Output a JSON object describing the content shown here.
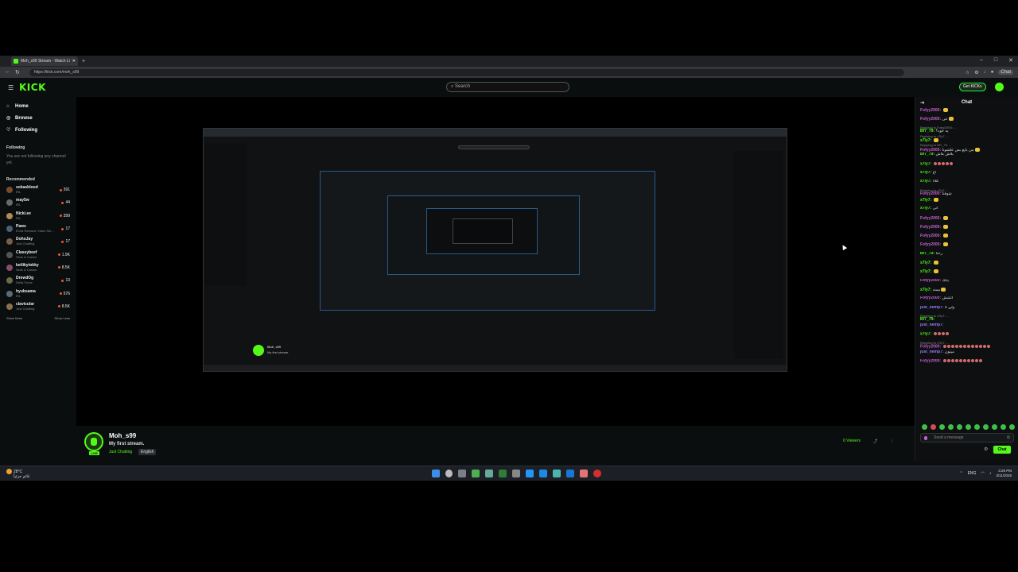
{
  "browser": {
    "tab_title": "Moh_s99 Stream - Watch Live",
    "url": "https://kick.com/moh_s99",
    "extension_chat_label": "Chat"
  },
  "header": {
    "logo": "KICK",
    "search_placeholder": "Search",
    "get_kicks_label": "Get KICKs"
  },
  "sidebar": {
    "nav": [
      {
        "label": "Home",
        "icon": "home-icon"
      },
      {
        "label": "Browse",
        "icon": "compass-icon"
      },
      {
        "label": "Following",
        "icon": "heart-icon"
      }
    ],
    "following_title": "Following",
    "following_empty": "You are not following any channel yet.",
    "recommended_title": "Recommended",
    "recommended": [
      {
        "name": "sokasblood",
        "category": "IRL",
        "viewers": "391",
        "color": "#7a4b2a"
      },
      {
        "name": "may5w",
        "category": "IRL",
        "viewers": "44",
        "color": "#6a6a6a"
      },
      {
        "name": "Nicki.ee",
        "category": "IRL",
        "viewers": "399",
        "color": "#b38a55"
      },
      {
        "name": "Paws",
        "category": "Extra Revised: Video Sto...",
        "viewers": "17",
        "color": "#4a5e7a"
      },
      {
        "name": "DohoJay",
        "category": "Just Chatting",
        "viewers": "17",
        "color": "#7b5e4a"
      },
      {
        "name": "Classybeef",
        "category": "Slots & Casino",
        "viewers": "1.9K",
        "color": "#555"
      },
      {
        "name": "ketlikytokky",
        "category": "Slots & Casino",
        "viewers": "8.5K",
        "color": "#8a4a6a"
      },
      {
        "name": "DrewdOg",
        "category": "Delta Force",
        "viewers": "13",
        "color": "#6b6b4a"
      },
      {
        "name": "hyubsama",
        "category": "IRL",
        "viewers": "576",
        "color": "#5a6a7a"
      },
      {
        "name": "clavicular",
        "category": "Just Chatting",
        "viewers": "8.5K",
        "color": "#8a7050"
      }
    ],
    "show_more": "Show More",
    "show_less": "Show Less"
  },
  "stream": {
    "channel": "Moh_s99",
    "title": "My first stream.",
    "category": "Just Chatting",
    "language": "English",
    "live_badge": "LIVE",
    "viewers": "0 Viewers"
  },
  "chat": {
    "title": "Chat",
    "messages": [
      {
        "reply": "",
        "user": "Fofyy2000:",
        "color": "#c95fd0",
        "text": "",
        "emotes": 1
      },
      {
        "reply": "",
        "user": "Fofyy2000:",
        "color": "#c95fd0",
        "text": "عی",
        "emotes": 1
      },
      {
        "reply": "Replying to Fofyy2000: ...",
        "user": "Bf7_79:",
        "color": "#53fc18",
        "text": "یه جود؟",
        "emotes": 0
      },
      {
        "reply": "Replying to x7ly7: ...",
        "user": "x7ly7:",
        "color": "#53fc18",
        "text": "",
        "emotes": 1
      },
      {
        "reply": "Replying to Bf7_79: ...",
        "user": "Fofyy2000:",
        "color": "#c95fd0",
        "text": "من بایع بس علشونا",
        "emotes": 1
      },
      {
        "reply": "",
        "user": "Bf7_79:",
        "color": "#53fc18",
        "text": "بلاش بلاش",
        "emotes": 0
      },
      {
        "reply": "",
        "user": "x7ly7:",
        "color": "#53fc18",
        "text": "",
        "emotes": 5
      },
      {
        "reply": "",
        "user": "x7ly7:",
        "color": "#53fc18",
        "text": "اخ",
        "emotes": 0
      },
      {
        "reply": "",
        "user": "x7ly7:",
        "color": "#53fc18",
        "text": "کلاء",
        "emotes": 0
      },
      {
        "reply": "Replying to x7ly7: ...",
        "user": "Fofyy2000:",
        "color": "#c95fd0",
        "text": "شوفنا",
        "emotes": 0
      },
      {
        "reply": "",
        "user": "x7ly7:",
        "color": "#53fc18",
        "text": "",
        "emotes": 1
      },
      {
        "reply": "",
        "user": "x7ly7:",
        "color": "#53fc18",
        "text": "انی",
        "emotes": 0
      },
      {
        "reply": "",
        "user": "Fofyy2000:",
        "color": "#c95fd0",
        "text": "",
        "emotes": 1
      },
      {
        "reply": "",
        "user": "Fofyy2000:",
        "color": "#c95fd0",
        "text": "",
        "emotes": 1
      },
      {
        "reply": "",
        "user": "Fofyy2000:",
        "color": "#c95fd0",
        "text": "",
        "emotes": 1
      },
      {
        "reply": "",
        "user": "Fofyy2000:",
        "color": "#c95fd0",
        "text": "",
        "emotes": 1
      },
      {
        "reply": "",
        "user": "Bf7_79:",
        "color": "#53fc18",
        "text": "رحنا",
        "emotes": 0
      },
      {
        "reply": "",
        "user": "x7ly7:",
        "color": "#53fc18",
        "text": "",
        "emotes": 1
      },
      {
        "reply": "",
        "user": "x7ly7:",
        "color": "#53fc18",
        "text": "",
        "emotes": 1
      },
      {
        "reply": "",
        "user": "Fofyy2000:",
        "color": "#c95fd0",
        "text": "يابك",
        "emotes": 0
      },
      {
        "reply": "",
        "user": "x7ly7:",
        "color": "#53fc18",
        "text": "ممنه",
        "emotes": 1
      },
      {
        "reply": "",
        "user": "Fofyy2000:",
        "color": "#c95fd0",
        "text": "اتشش",
        "emotes": 0
      },
      {
        "reply": "",
        "user": "just_nemp7:",
        "color": "#9b7bff",
        "text": "ولي لا",
        "emotes": 0
      },
      {
        "reply": "Replying to x7ly7: ...",
        "user": "Bf7_79:",
        "color": "#53fc18",
        "text": "",
        "emotes": 0
      },
      {
        "reply": "",
        "user": "just_nemp7:",
        "color": "#9b7bff",
        "text": "",
        "emotes": 0
      },
      {
        "reply": "",
        "user": "x7ly7:",
        "color": "#53fc18",
        "text": "",
        "emotes": 4
      },
      {
        "reply": "Replying to x7ly7: ...",
        "user": "Fofyy2000:",
        "color": "#c95fd0",
        "text": "",
        "emotes": 12
      },
      {
        "reply": "",
        "user": "just_nemp7:",
        "color": "#9b7bff",
        "text": "ميتون",
        "emotes": 0
      },
      {
        "reply": "",
        "user": "Fofyy2000:",
        "color": "#c95fd0",
        "text": "",
        "emotes": 10
      }
    ],
    "send_placeholder": "Send a message",
    "send_label": "Chat"
  },
  "taskbar": {
    "temperature": "28°C",
    "weather_desc": "غائم جزئياً",
    "language": "ENG",
    "time": "3:29 PM",
    "date": "3/11/2026"
  }
}
